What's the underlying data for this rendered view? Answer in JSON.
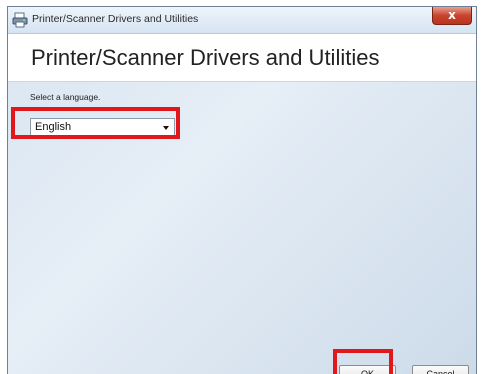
{
  "window": {
    "title": "Printer/Scanner Drivers and Utilities",
    "close_label": "x"
  },
  "header": {
    "title": "Printer/Scanner Drivers and Utilities"
  },
  "language": {
    "prompt": "Select a language.",
    "selected": "English"
  },
  "buttons": {
    "ok_label": "OK",
    "cancel_label": "Cancel"
  },
  "colors": {
    "highlight": "#e0181b",
    "close_button": "#c9442d"
  },
  "icons": {
    "app": "printer-scanner-icon",
    "dropdown": "chevron-down-icon"
  }
}
